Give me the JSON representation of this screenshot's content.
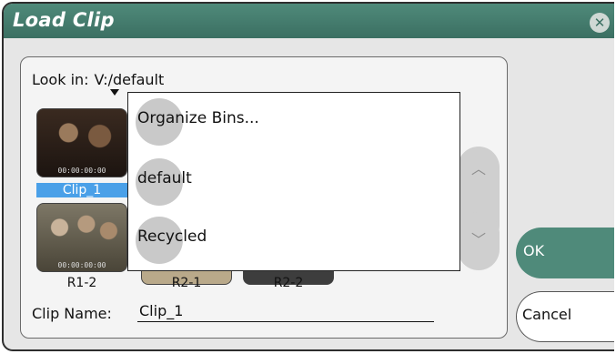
{
  "window": {
    "title": "Load Clip",
    "close_icon": "close-icon"
  },
  "browser": {
    "lookin_label": "Look in:",
    "lookin_value": "V:/default",
    "clips": [
      {
        "label": "Clip_1",
        "selected": true
      },
      {
        "label": "R1-2",
        "selected": false
      },
      {
        "label": "R2-1",
        "selected": false
      },
      {
        "label": "R2-2",
        "selected": false
      }
    ],
    "scroll_up_icon": "chevron-up-icon",
    "scroll_down_icon": "chevron-down-icon",
    "clipname_label": "Clip Name:",
    "clipname_value": "Clip_1"
  },
  "dropdown": {
    "items": [
      {
        "label": "Organize Bins..."
      },
      {
        "label": "default"
      },
      {
        "label": "Recycled"
      }
    ]
  },
  "buttons": {
    "ok": "OK",
    "cancel": "Cancel"
  },
  "colors": {
    "accent": "#4f8a7a",
    "selection": "#4aa0e8"
  }
}
